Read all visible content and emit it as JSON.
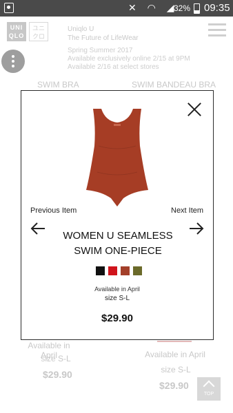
{
  "status_bar": {
    "battery_pct": "32%",
    "time": "09:35",
    "icons": [
      "mute-icon",
      "wifi-icon",
      "signal-icon",
      "battery-icon",
      "screenshot-icon"
    ]
  },
  "header": {
    "logo_text": "UNI QLO",
    "brand_line1": "Uniqlo U",
    "brand_line2": "The Future of LifeWear",
    "announce_line1": "Spring Summer 2017",
    "announce_line2": "Available exclusively online 2/15 at 9PM",
    "announce_line3": "Available 2/16 at select stores"
  },
  "background_products": {
    "left_label": "SWIM BRA",
    "right_label": "SWIM BANDEAU BRA",
    "left_availability": "Available in April",
    "left_size": "size S-L",
    "left_price": "$29.90",
    "right_availability": "Available in April",
    "right_size": "size S-L",
    "right_price": "$29.90",
    "top_button": "TOP"
  },
  "modal": {
    "previous_label": "Previous Item",
    "next_label": "Next Item",
    "title_line1": "WOMEN U SEAMLESS",
    "title_line2": "SWIM ONE-PIECE",
    "availability": "Available in April",
    "size": "size S-L",
    "price": "$29.90",
    "swatch_colors": [
      "#111111",
      "#d0141c",
      "#a3402a",
      "#6b6a2a"
    ],
    "product_color": "#a63d25"
  }
}
